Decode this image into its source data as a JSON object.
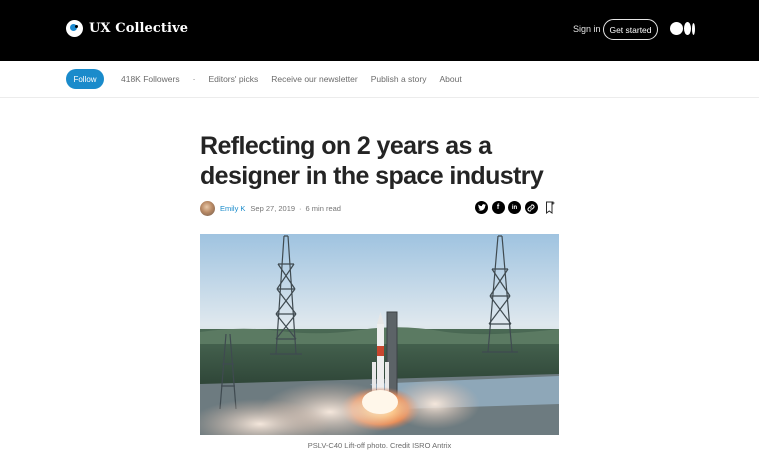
{
  "header": {
    "brand_name": "UX Collective",
    "sign_in": "Sign in",
    "get_started": "Get started",
    "medium_logo_icon": "medium-logo-icon"
  },
  "pub_nav": {
    "follow": "Follow",
    "followers": "418K Followers",
    "separator": "·",
    "items": [
      "Editors' picks",
      "Receive our newsletter",
      "Publish a story",
      "About"
    ]
  },
  "article": {
    "title": "Reflecting on 2 years as a designer in the space industry",
    "author": "Emily K",
    "date": "Sep 27, 2019",
    "dot": "·",
    "read_time": "6 min read",
    "share_icons": [
      "twitter-icon",
      "facebook-icon",
      "linkedin-icon",
      "link-icon",
      "bookmark-icon"
    ],
    "image_caption": "PSLV-C40 Lift-off photo. Credit ISRO Antrix"
  },
  "colors": {
    "topbar": "#000000",
    "accent": "#1a8bcb",
    "text": "#242424",
    "muted": "#6b6b6b"
  }
}
